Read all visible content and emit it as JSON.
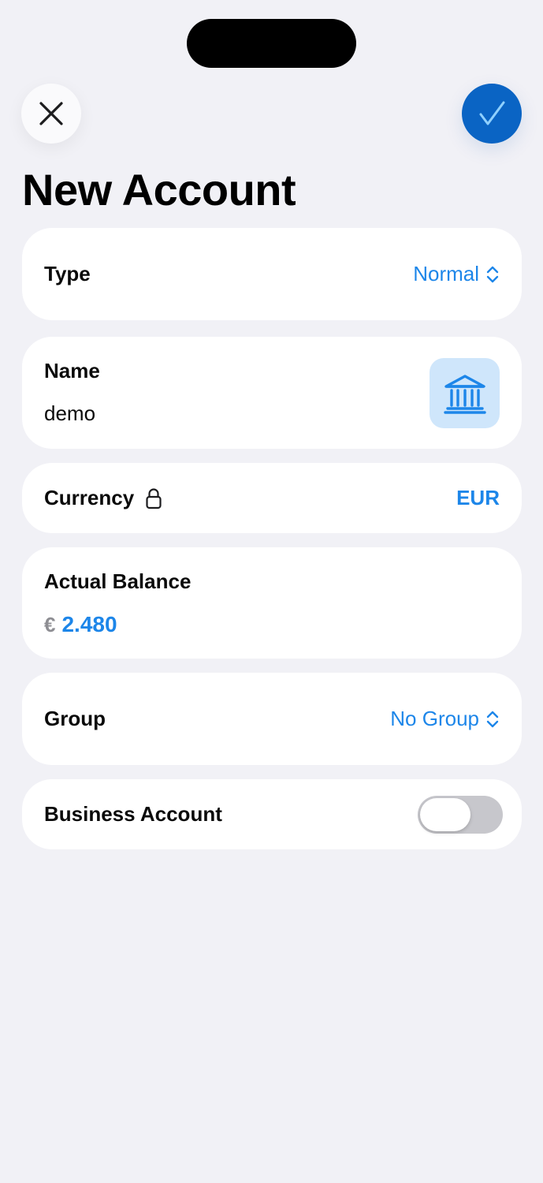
{
  "header": {
    "title": "New Account",
    "close_icon": "close-icon",
    "confirm_icon": "checkmark-icon",
    "accent_color": "#0a64c4"
  },
  "form": {
    "type": {
      "label": "Type",
      "value": "Normal",
      "icon": "chevron-up-down-icon"
    },
    "name": {
      "label": "Name",
      "value": "demo",
      "icon": "bank-icon"
    },
    "currency": {
      "label": "Currency",
      "value": "EUR",
      "icon": "lock-icon"
    },
    "balance": {
      "label": "Actual Balance",
      "currency_symbol": "€",
      "amount": "2.480"
    },
    "group": {
      "label": "Group",
      "value": "No Group",
      "icon": "chevron-up-down-icon"
    },
    "business": {
      "label": "Business Account",
      "toggle_on": false
    }
  },
  "colors": {
    "background": "#f1f1f6",
    "blue": "#1d86e9",
    "card": "#ffffff"
  }
}
